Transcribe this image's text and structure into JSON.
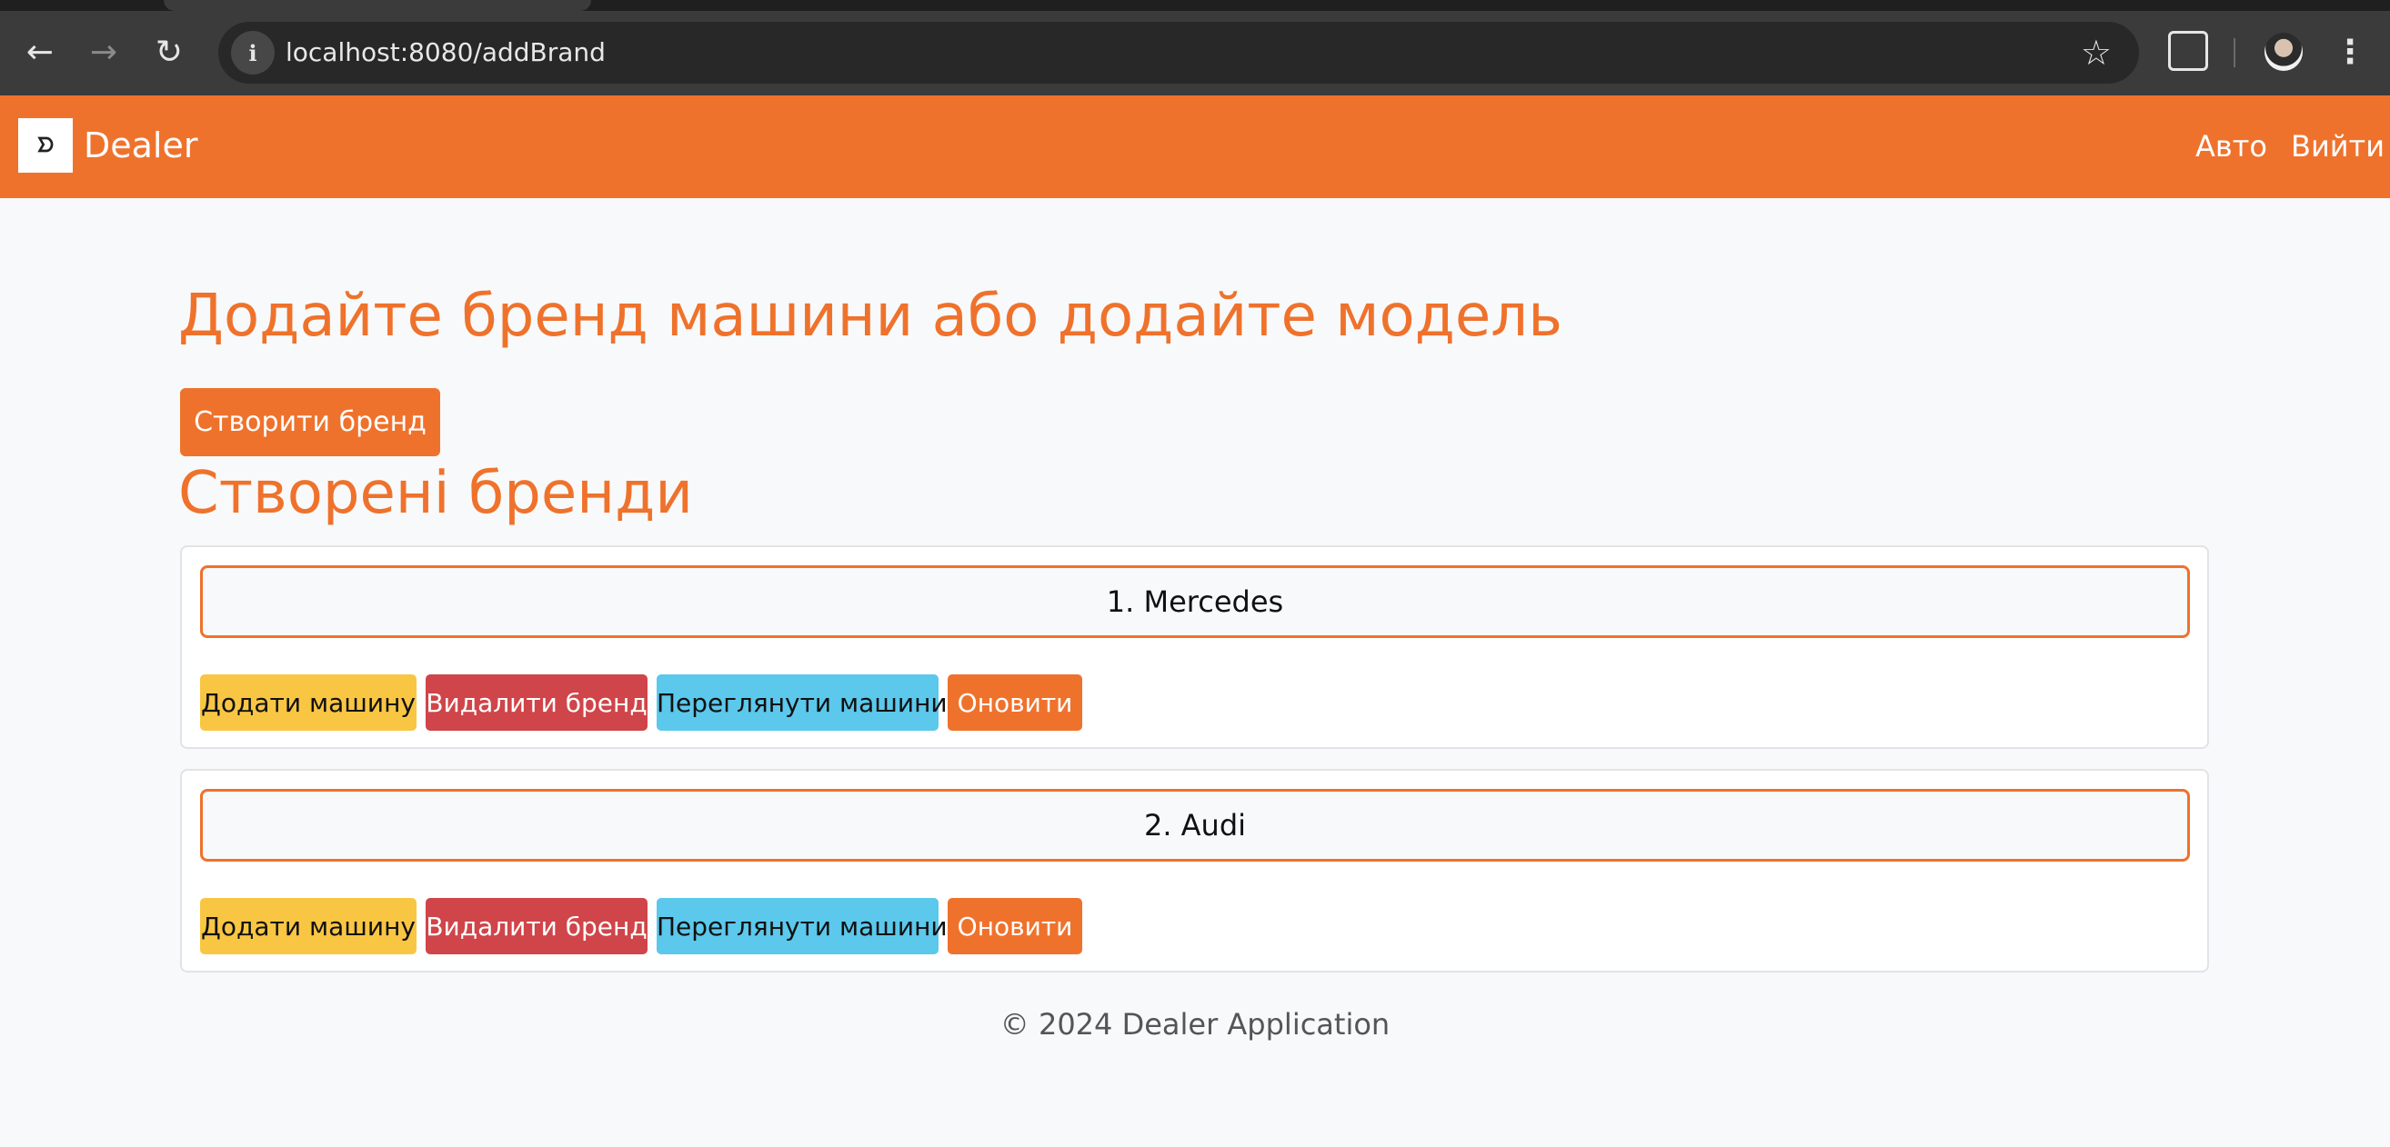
{
  "browser": {
    "url_host": "localhost",
    "url_path": ":8080/addBrand",
    "back_icon": "←",
    "forward_icon": "→",
    "reload_icon": "↻",
    "site_info_icon": "i",
    "star_icon": "☆",
    "menu_icon": "⋮"
  },
  "navbar": {
    "brand_logo_text": "ᗤ",
    "brand_name": "Dealer",
    "links": {
      "auto": "Авто",
      "logout": "Вийти"
    },
    "color": "#ef722c"
  },
  "main": {
    "title": "Додайте бренд машини або додайте модель",
    "create_button": "Створити бренд",
    "subtitle": "Створені бренди",
    "brands": [
      {
        "name": "1. Mercedes",
        "actions": {
          "add_car": "Додати машину",
          "delete_brand": "Видалити бренд",
          "view_cars": "Переглянути машини",
          "update": "Оновити"
        }
      },
      {
        "name": "2. Audi",
        "actions": {
          "add_car": "Додати машину",
          "delete_brand": "Видалити бренд",
          "view_cars": "Переглянути машини",
          "update": "Оновити"
        }
      }
    ]
  },
  "footer": {
    "text": "© 2024 Dealer Application"
  },
  "colors": {
    "accent": "#ef722c",
    "warning": "#f9c644",
    "danger": "#cf4549",
    "info": "#5bc8ec"
  }
}
